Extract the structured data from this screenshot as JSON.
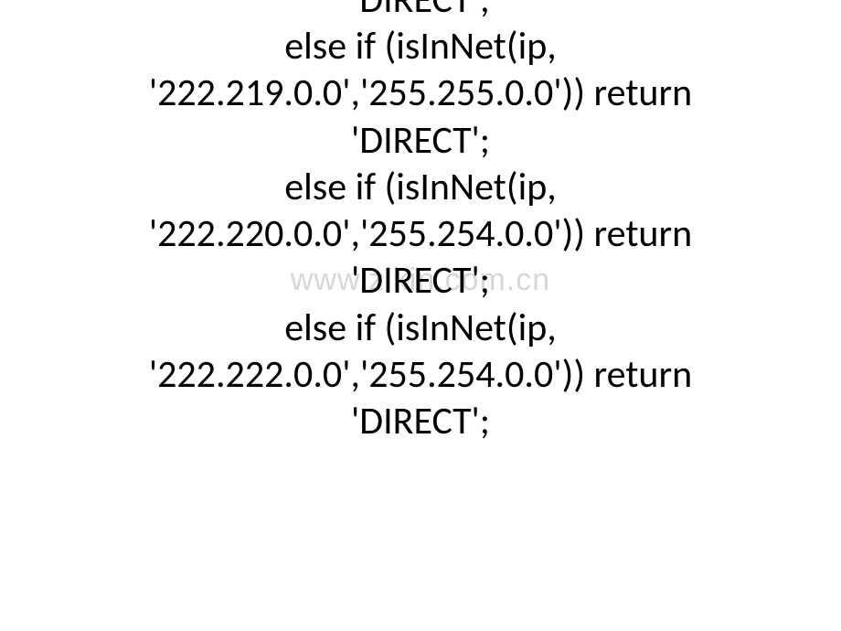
{
  "watermark": "www.zikin.com.cn",
  "lines": {
    "l0": "'DIRECT';",
    "l1": "else if (isInNet(ip,",
    "l2": "'222.219.0.0','255.255.0.0')) return",
    "l3": "'DIRECT';",
    "l4": "else if (isInNet(ip,",
    "l5": "'222.220.0.0','255.254.0.0')) return",
    "l6": "'DIRECT';",
    "l7": "else if (isInNet(ip,",
    "l8": "'222.222.0.0','255.254.0.0')) return",
    "l9": "'DIRECT';"
  }
}
